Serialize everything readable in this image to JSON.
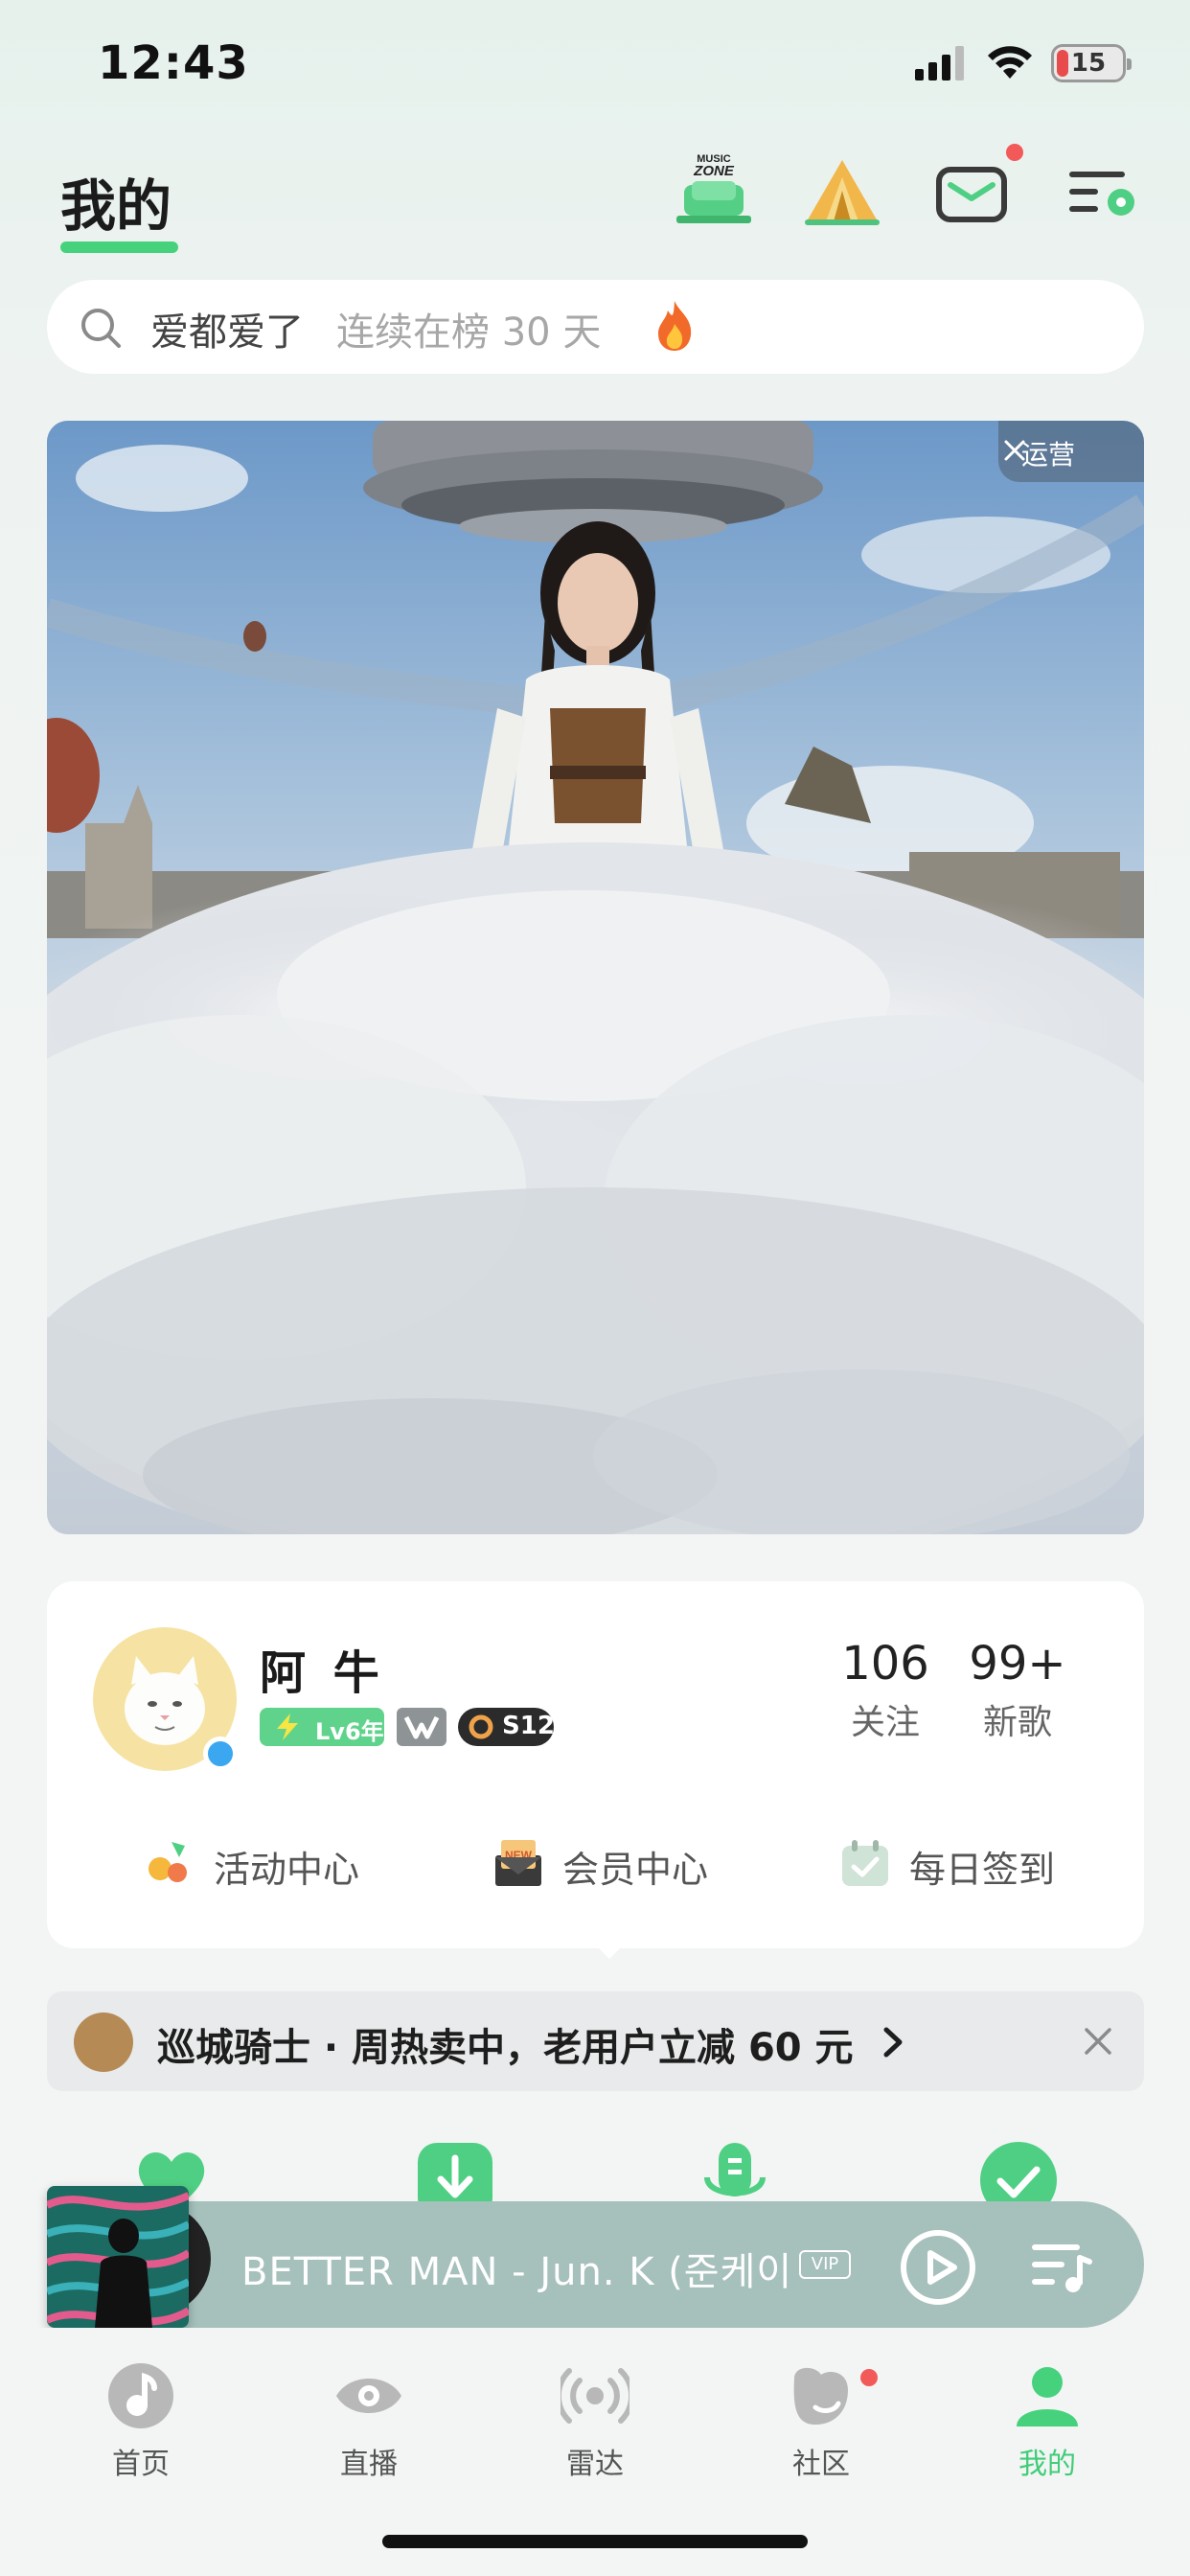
{
  "status_bar": {
    "time": "12:43",
    "battery": "15"
  },
  "header": {
    "title": "我的",
    "zone_logo_text": "MUSIC ZONE"
  },
  "search": {
    "hot_query": "爱都爱了",
    "hot_meta": "连续在榜 30 天"
  },
  "banner": {
    "ad_label": "运营"
  },
  "profile": {
    "name": "阿 牛",
    "level_badge": "Lv6年",
    "s12_badge": "S12",
    "following_count": "106",
    "following_label": "关注",
    "new_songs_count": "99+",
    "new_songs_label": "新歌",
    "quick_links": [
      {
        "label": "活动中心",
        "icon": "activity-center-icon"
      },
      {
        "label": "会员中心",
        "icon": "member-center-icon"
      },
      {
        "label": "每日签到",
        "icon": "daily-checkin-icon"
      }
    ]
  },
  "promo": {
    "text": "巡城骑士 · 周热卖中，老用户立减 60 元"
  },
  "player": {
    "song": "BETTER MAN - Jun. K (준케이",
    "vip_tag": "VIP"
  },
  "tabbar": {
    "tabs": [
      {
        "label": "首页",
        "icon": "home-note-icon"
      },
      {
        "label": "直播",
        "icon": "live-eye-icon"
      },
      {
        "label": "雷达",
        "icon": "radar-icon"
      },
      {
        "label": "社区",
        "icon": "community-icon"
      },
      {
        "label": "我的",
        "icon": "profile-icon",
        "active": true
      }
    ]
  },
  "colors": {
    "accent": "#46d27d",
    "badge_red": "#f25a5a",
    "player_bg": "#a6c0bc"
  }
}
